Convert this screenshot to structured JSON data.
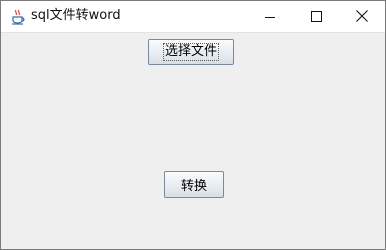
{
  "window": {
    "title": "sql文件转word",
    "app_icon": "java-coffee-cup-icon",
    "controls": {
      "minimize_icon": "minimize-icon",
      "maximize_icon": "maximize-icon",
      "close_icon": "close-icon"
    }
  },
  "main": {
    "select_file_label": "选择文件",
    "convert_label": "转换"
  }
}
